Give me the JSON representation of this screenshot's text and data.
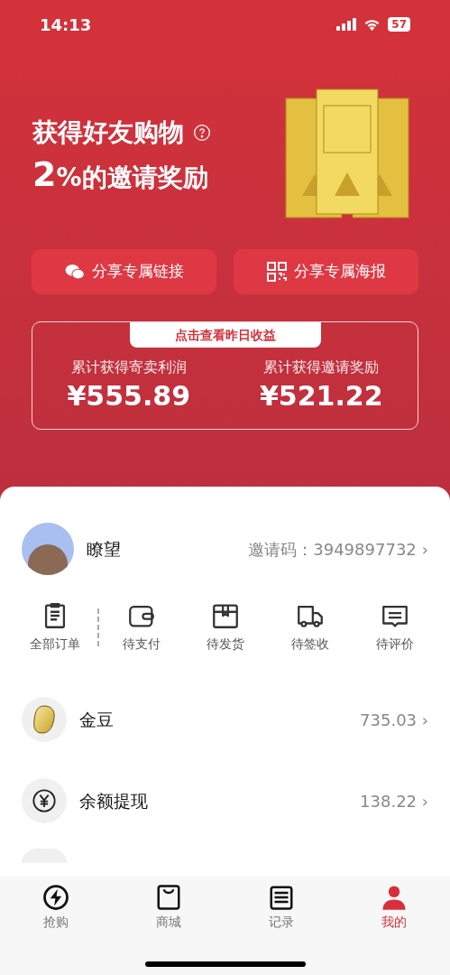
{
  "status_bar": {
    "time": "14:13",
    "battery": "57"
  },
  "promo": {
    "title_line1": "获得好友购物",
    "title_rate": "2",
    "title_rest": "%的邀请奖励"
  },
  "share_buttons": [
    {
      "kind": "wechat",
      "label": "分享专属链接"
    },
    {
      "kind": "qr",
      "label": "分享专属海报"
    }
  ],
  "earnings": {
    "tab_label": "点击查看昨日收益",
    "stats": [
      {
        "label": "累计获得寄卖利润",
        "value": "¥555.89"
      },
      {
        "label": "累计获得邀请奖励",
        "value": "¥521.22"
      }
    ]
  },
  "profile": {
    "name": "瞭望",
    "invite_label": "邀请码：",
    "invite_code": "3949897732",
    "chevron": "›"
  },
  "orders": [
    {
      "kind": "clipboard",
      "label": "全部订单"
    },
    {
      "kind": "wallet",
      "label": "待支付"
    },
    {
      "kind": "box",
      "label": "待发货"
    },
    {
      "kind": "truck",
      "label": "待签收"
    },
    {
      "kind": "comment",
      "label": "待评价"
    }
  ],
  "list_rows": [
    {
      "kind": "bean",
      "label": "金豆",
      "value": "735.03",
      "chevron": "›"
    },
    {
      "kind": "yen",
      "label": "余额提现",
      "value": "138.22",
      "chevron": "›"
    }
  ],
  "tab_bar": [
    {
      "kind": "bolt",
      "label": "抢购",
      "selected": false
    },
    {
      "kind": "bag",
      "label": "商城",
      "selected": false
    },
    {
      "kind": "list",
      "label": "记录",
      "selected": false
    },
    {
      "kind": "person",
      "label": "我的",
      "selected": true
    }
  ]
}
